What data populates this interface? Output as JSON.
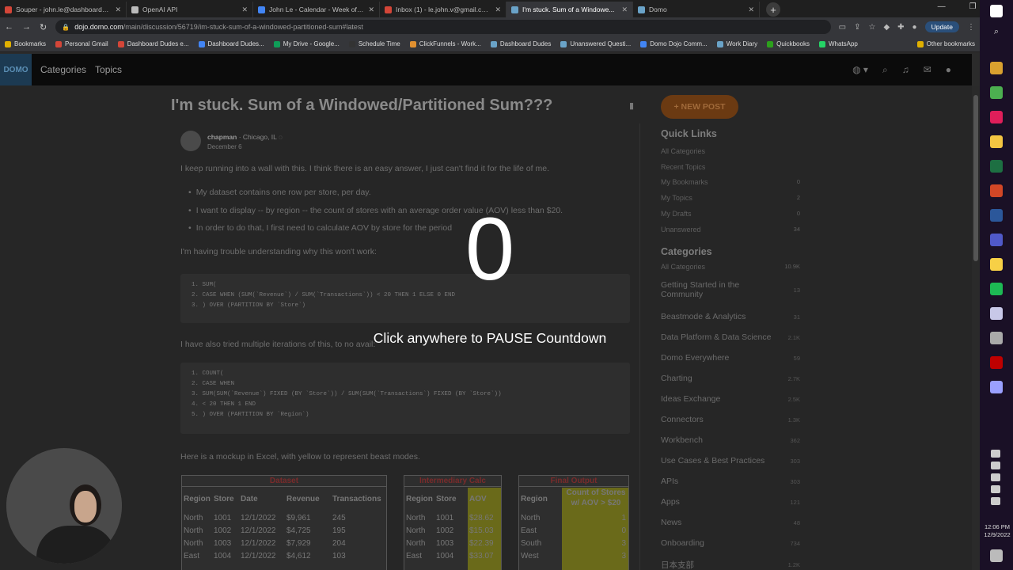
{
  "browser": {
    "tabs": [
      {
        "label": "Souper - john.le@dashboarddude...",
        "color": "#d44638"
      },
      {
        "label": "OpenAI API",
        "color": "#bbbbbb"
      },
      {
        "label": "John Le - Calendar - Week of De...",
        "color": "#4285f4"
      },
      {
        "label": "Inbox (1) - le.john.v@gmail.com...",
        "color": "#d44638"
      },
      {
        "label": "I'm stuck. Sum of a Windowe...",
        "color": "#6aa3c8",
        "active": true
      },
      {
        "label": "Domo",
        "color": "#6aa3c8"
      }
    ],
    "url_host": "dojo.domo.com",
    "url_path": "/main/discussion/56719/im-stuck-sum-of-a-windowed-partitioned-sum#latest",
    "update_label": "Update",
    "bookmarks": [
      {
        "label": "Bookmarks",
        "color": "#e0b000"
      },
      {
        "label": "Personal Gmail",
        "color": "#d44638"
      },
      {
        "label": "Dashboard Dudes e...",
        "color": "#d44638"
      },
      {
        "label": "Dashboard Dudes...",
        "color": "#4285f4"
      },
      {
        "label": "My Drive - Google...",
        "color": "#0f9d58"
      },
      {
        "label": "Schedule Time",
        "color": "#333333"
      },
      {
        "label": "ClickFunnels - Work...",
        "color": "#e09030"
      },
      {
        "label": "Dashboard Dudes",
        "color": "#6aa3c8"
      },
      {
        "label": "Unanswered Questi...",
        "color": "#6aa3c8"
      },
      {
        "label": "Domo Dojo Comm...",
        "color": "#4285f4"
      },
      {
        "label": "Work Diary",
        "color": "#6aa3c8"
      },
      {
        "label": "Quickbooks",
        "color": "#2ca01c"
      },
      {
        "label": "WhatsApp",
        "color": "#25d366"
      }
    ],
    "other_bookmarks": "Other bookmarks"
  },
  "site": {
    "logo": "DOMO",
    "nav": [
      "Categories",
      "Topics"
    ]
  },
  "post": {
    "title": "I'm stuck. Sum of a Windowed/Partitioned Sum???",
    "author": "chapman",
    "location": "Chicago, IL",
    "date": "December 6",
    "intro": "I keep running into a wall with this. I think there is an easy answer, I just can't find it for the life of me.",
    "bullets": [
      "My dataset contains one row per store, per day.",
      "I want to display -- by region -- the count of stores with an average order value (AOV) less than $20.",
      "In order to do that, I first need to calculate AOV by store for the period"
    ],
    "trouble": "I'm having trouble understanding why this won't work:",
    "code1": [
      "1. SUM(",
      "2. CASE WHEN (SUM(`Revenue`) / SUM(`Transactions`)) < 20 THEN 1 ELSE 0 END",
      "3. ) OVER (PARTITION BY `Store`)"
    ],
    "also": "I have also tried multiple iterations of this, to no avail:",
    "code2": [
      "1. COUNT(",
      "2. CASE WHEN",
      "3. SUM(SUM(`Revenue`) FIXED (BY `Store`)) / SUM(SUM(`Transactions`) FIXED (BY `Store`))",
      "4. < 20 THEN 1 END",
      "5. ) OVER (PARTITION BY `Region`)"
    ],
    "mockup": "Here is a mockup in Excel, with yellow to represent beast modes."
  },
  "tables": {
    "dataset": {
      "title": "Dataset",
      "headers": [
        "Region",
        "Store",
        "Date",
        "Revenue",
        "Transactions"
      ],
      "rows": [
        [
          "North",
          "1001",
          "12/1/2022",
          "$9,961",
          "245"
        ],
        [
          "North",
          "1002",
          "12/1/2022",
          "$4,725",
          "195"
        ],
        [
          "North",
          "1003",
          "12/1/2022",
          "$7,929",
          "204"
        ],
        [
          "East",
          "1004",
          "12/1/2022",
          "$4,612",
          "103"
        ]
      ]
    },
    "intermediary": {
      "title": "Intermediary Calc",
      "headers": [
        "Region",
        "Store",
        "AOV"
      ],
      "rows": [
        [
          "North",
          "1001",
          "$28.62"
        ],
        [
          "North",
          "1002",
          "$15.03"
        ],
        [
          "North",
          "1003",
          "$22.39"
        ],
        [
          "East",
          "1004",
          "$33.07"
        ]
      ]
    },
    "final": {
      "title": "Final Output",
      "headers": [
        "Region",
        "Count of Stores",
        "w/ AOV > $20"
      ],
      "rows": [
        [
          "North",
          "1"
        ],
        [
          "East",
          "0"
        ],
        [
          "South",
          "3"
        ],
        [
          "West",
          "3"
        ]
      ]
    }
  },
  "sidebar": {
    "new_post": "+ NEW POST",
    "quick_links_title": "Quick Links",
    "quick_links": [
      {
        "label": "All Categories",
        "count": ""
      },
      {
        "label": "Recent Topics",
        "count": ""
      },
      {
        "label": "My Bookmarks",
        "count": "0"
      },
      {
        "label": "My Topics",
        "count": "2"
      },
      {
        "label": "My Drafts",
        "count": "0"
      },
      {
        "label": "Unanswered",
        "count": "34"
      }
    ],
    "categories_title": "Categories",
    "all_categories": {
      "label": "All Categories",
      "count": "10.9K"
    },
    "categories": [
      {
        "label": "Getting Started in the",
        "label2": "Community",
        "count": "13"
      },
      {
        "label": "Beastmode & Analytics",
        "count": "31"
      },
      {
        "label": "Data Platform & Data Science",
        "count": "2.1K"
      },
      {
        "label": "Domo Everywhere",
        "count": "59"
      },
      {
        "label": "Charting",
        "count": "2.7K"
      },
      {
        "label": "Ideas Exchange",
        "count": "2.5K"
      },
      {
        "label": "Connectors",
        "count": "1.3K"
      },
      {
        "label": "Workbench",
        "count": "362"
      },
      {
        "label": "Use Cases & Best Practices",
        "count": "303"
      },
      {
        "label": "APIs",
        "count": "303"
      },
      {
        "label": "Apps",
        "count": "121"
      },
      {
        "label": "News",
        "count": "48"
      },
      {
        "label": "Onboarding",
        "count": "734"
      },
      {
        "label": "日本支部",
        "count": "1.2K"
      }
    ]
  },
  "overlay": {
    "countdown": "0",
    "message": "Click anywhere to PAUSE Countdown"
  },
  "taskbar": {
    "icons": [
      {
        "name": "chrome-icon",
        "color": "#d9a12f"
      },
      {
        "name": "chrome-icon",
        "color": "#4caf50"
      },
      {
        "name": "slack-icon",
        "color": "#e01e5a"
      },
      {
        "name": "file-explorer-icon",
        "color": "#f4c542"
      },
      {
        "name": "excel-icon",
        "color": "#1d6f42"
      },
      {
        "name": "powerpoint-icon",
        "color": "#d24726"
      },
      {
        "name": "word-icon",
        "color": "#2b579a"
      },
      {
        "name": "teams-icon",
        "color": "#5059c9"
      },
      {
        "name": "sticky-notes-icon",
        "color": "#f7d046"
      },
      {
        "name": "spotify-icon",
        "color": "#1db954"
      },
      {
        "name": "app-icon",
        "color": "#c8c8e8"
      },
      {
        "name": "screenshot-icon",
        "color": "#aaaaaa"
      },
      {
        "name": "filezilla-icon",
        "color": "#bf0000"
      },
      {
        "name": "notes-icon",
        "color": "#9aa0ff"
      }
    ],
    "time": "12:06 PM",
    "date": "12/9/2022"
  }
}
